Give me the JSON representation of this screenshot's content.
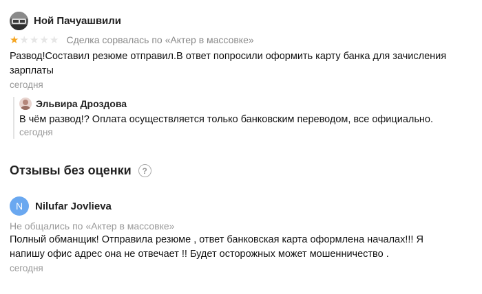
{
  "review1": {
    "author": "Ной Пачуашвили",
    "rating": 1,
    "max_rating": 5,
    "deal_status": "Сделка сорвалась по «Актер в массовке»",
    "text": "Развод!Составил резюме отправил.В ответ попросили оформить карту банка для зачисления зарплаты",
    "date": "сегодня",
    "reply": {
      "author": "Эльвира Дроздова",
      "text": "В чём развод!? Оплата осуществляется только банковским переводом, все официально.",
      "date": "сегодня"
    }
  },
  "section": {
    "title": "Отзывы без оценки",
    "help_icon": "?"
  },
  "review2": {
    "avatar_letter": "N",
    "author": "Nilufar Jovlieva",
    "deal_status": "Не общались по «Актер в массовке»",
    "text": "Полный обманщик! Отправила резюме , ответ банковская карта оформлена началах!!! Я напишу офис адрес она не отвечает !! Будет осторожных может мошенничество .",
    "date": "сегодня"
  },
  "colors": {
    "star_filled": "#f5a623",
    "star_empty": "#e6e6e6",
    "avatar_letter_bg": "#6aa8f0",
    "muted_text": "#999999"
  }
}
